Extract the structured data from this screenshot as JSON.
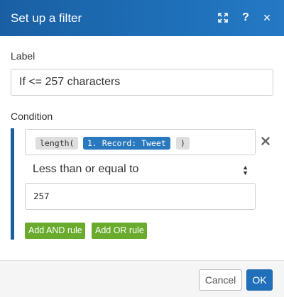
{
  "dialog": {
    "title": "Set up a filter"
  },
  "header_icons": [
    "expand-icon",
    "help-icon",
    "close-icon"
  ],
  "header_help_glyph": "?",
  "header_close_glyph": "×",
  "label_section": {
    "label": "Label",
    "value": "If <= 257 characters"
  },
  "condition_section": {
    "label": "Condition",
    "expression": {
      "function_open": "length(",
      "variable": "1. Record: Tweet",
      "function_close": ")"
    },
    "remove_glyph": "×",
    "operator": "Less than or equal to",
    "operator_caret_up": "▲",
    "operator_caret_down": "▼",
    "value": "257",
    "add_and_rule": "Add AND rule",
    "add_or_rule": "Add OR rule"
  },
  "footer": {
    "cancel": "Cancel",
    "ok": "OK"
  },
  "colors": {
    "header": "#1e6fb8",
    "accent_bar": "#1a5fa3",
    "variable_pill": "#2a78be",
    "rule_buttons": "#6aab2e",
    "ok_button": "#1f6fbb"
  }
}
